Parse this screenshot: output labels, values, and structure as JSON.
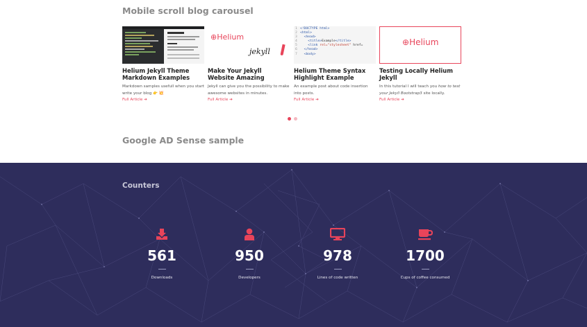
{
  "carousel": {
    "title": "Mobile scroll blog carousel",
    "cards": [
      {
        "title": "Helium Jekyll Theme Markdown Examples",
        "excerpt": "Markdown samples usefull when you start write your blog 👉 💥",
        "more": "Full Article"
      },
      {
        "title": "Make Your Jekyll Website Amazing",
        "excerpt": "Jekyll can give you the possibility to make awesome websites in minutes.",
        "more": "Full Article",
        "thumb_logo": "Helium",
        "thumb_logo2": "jekyll"
      },
      {
        "title": "Helium Theme Syntax Highlight Example",
        "excerpt": "An example post about code insertion into posts.",
        "more": "Full Article"
      },
      {
        "title": "Testing Locally Helium Jekyll",
        "excerpt_pre": "In this tutorial I will teach you ",
        "excerpt_em": "how to test your Jekyll Bootstrap3",
        "excerpt_post": " site locally.",
        "more": "Full Article",
        "thumb_logo": "Helium"
      }
    ],
    "active_slide": 1,
    "slides": 2
  },
  "adsense": {
    "title": "Google AD Sense sample"
  },
  "counters": {
    "title": "Counters",
    "items": [
      {
        "value": "561",
        "label": "Downloads",
        "icon": "download-icon"
      },
      {
        "value": "950",
        "label": "Developers",
        "icon": "user-icon"
      },
      {
        "value": "978",
        "label": "Lines of code written",
        "icon": "desktop-icon"
      },
      {
        "value": "1700",
        "label": "Cups of coffee consumed",
        "icon": "coffee-icon"
      }
    ]
  },
  "colors": {
    "accent": "#e8445a",
    "counters_bg": "#2e2d5c"
  }
}
